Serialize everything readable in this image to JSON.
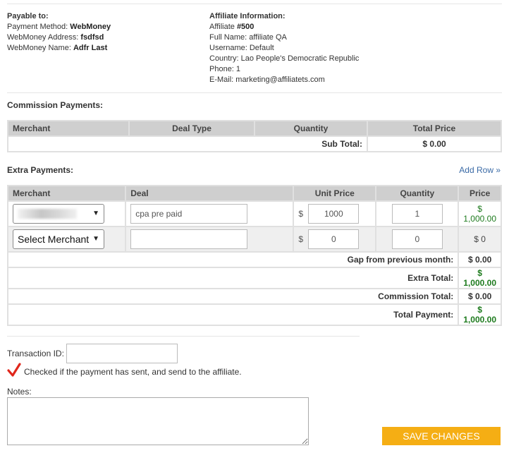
{
  "payable": {
    "heading": "Payable to:",
    "method_label": "Payment Method:",
    "method_value": "WebMoney",
    "address_label": "WebMoney Address:",
    "address_value": "fsdfsd",
    "name_label": "WebMoney Name:",
    "name_value": "Adfr Last"
  },
  "affiliate": {
    "heading": "Affiliate Information:",
    "id_label": "Affiliate",
    "id_value": "#500",
    "full_name": "Full Name: affiliate QA",
    "username": "Username: Default",
    "country": "Country: Lao People's Democratic Republic",
    "phone": "Phone: 1",
    "email": "E-Mail: marketing@affiliatets.com"
  },
  "commission": {
    "title": "Commission Payments:",
    "headers": [
      "Merchant",
      "Deal Type",
      "Quantity",
      "Total Price"
    ],
    "subtotal_label": "Sub Total:",
    "subtotal_value": "$ 0.00"
  },
  "extra": {
    "title": "Extra Payments:",
    "add_row": "Add Row »",
    "headers": [
      "Merchant",
      "Deal",
      "Unit Price",
      "Quantity",
      "Price"
    ],
    "rows": [
      {
        "merchant": "",
        "deal": "cpa pre paid",
        "currency": "$",
        "unit_price": "1000",
        "quantity": "1",
        "price": "$ 1,000.00"
      },
      {
        "merchant": "Select Merchant",
        "deal": "",
        "currency": "$",
        "unit_price": "0",
        "quantity": "0",
        "price": "$ 0"
      }
    ],
    "totals": [
      {
        "label": "Gap from previous month:",
        "value": "$ 0.00"
      },
      {
        "label": "Extra Total:",
        "value": "$ 1,000.00"
      },
      {
        "label": "Commission Total:",
        "value": "$ 0.00"
      },
      {
        "label": "Total Payment:",
        "value": "$ 1,000.00"
      }
    ]
  },
  "transaction": {
    "id_label": "Transaction ID:",
    "id_value": "",
    "checkbox_label": "Checked if the payment has sent, and send to the affiliate.",
    "notes_label": "Notes:",
    "notes_value": ""
  },
  "save_button": "SAVE CHANGES",
  "colors": {
    "accent": "#f5ae14",
    "positive": "#1e7b1e",
    "link": "#3a6aa6",
    "check": "#e0261b"
  }
}
